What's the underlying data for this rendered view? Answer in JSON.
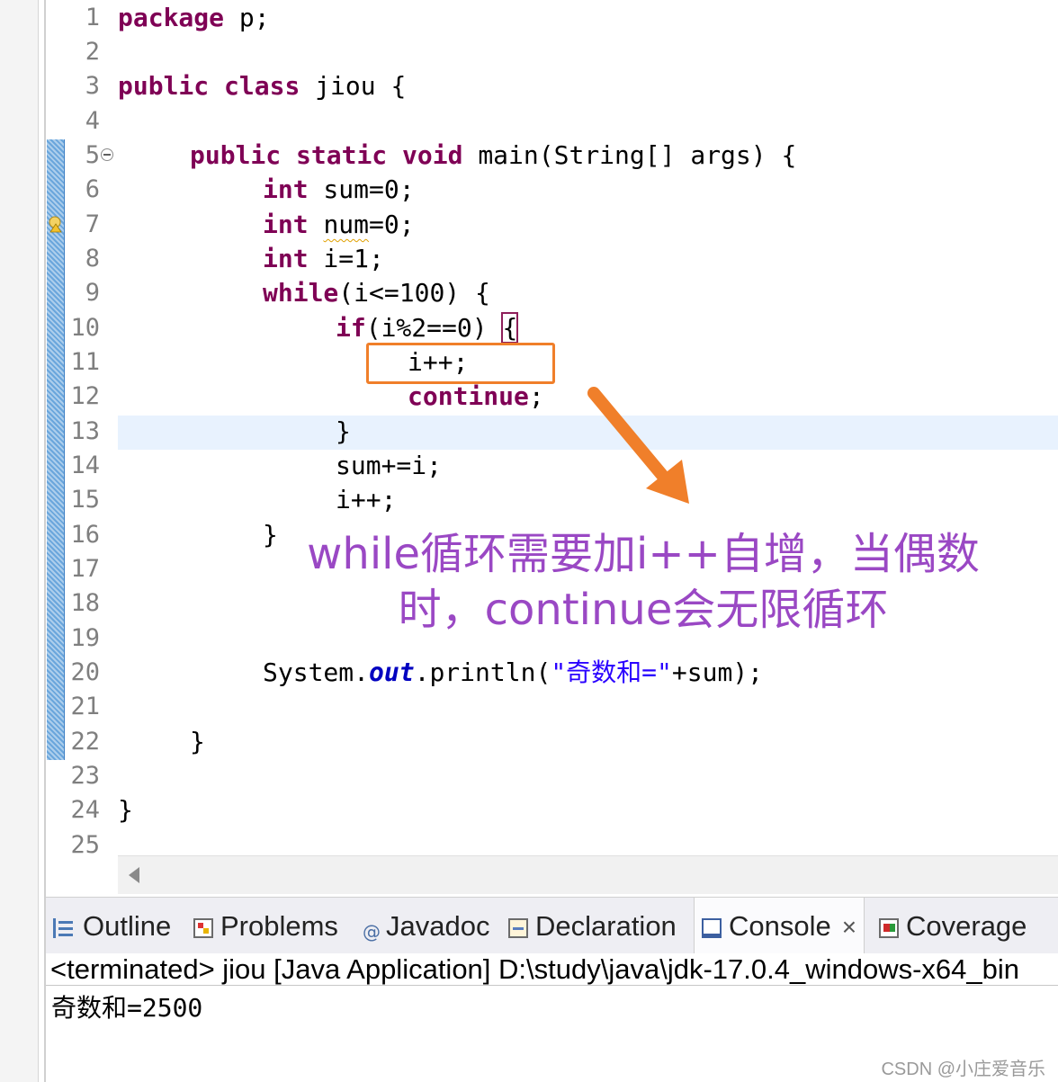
{
  "editor": {
    "line_numbers": [
      "1",
      "2",
      "3",
      "4",
      "5",
      "6",
      "7",
      "8",
      "9",
      "10",
      "11",
      "12",
      "13",
      "14",
      "15",
      "16",
      "17",
      "18",
      "19",
      "20",
      "21",
      "22",
      "23",
      "24",
      "25"
    ],
    "code": {
      "l1": {
        "kw": "package",
        "rest": " p;"
      },
      "l3": {
        "kw1": "public",
        "kw2": "class",
        "rest": " jiou {"
      },
      "l5": {
        "kw1": "public",
        "kw2": "static",
        "kw3": "void",
        "rest": " main(String[] args) {"
      },
      "l6": {
        "kw": "int",
        "rest": " sum=0;"
      },
      "l7": {
        "kw": "int",
        "var": "num",
        "rest": "=0;"
      },
      "l8": {
        "kw": "int",
        "rest": " i=1;"
      },
      "l9": {
        "kw": "while",
        "rest": "(i<=100) {"
      },
      "l10": {
        "kw": "if",
        "rest": "(i%2==0) ",
        "brace": "{"
      },
      "l11": {
        "text": "i++;"
      },
      "l12": {
        "kw": "continue",
        "rest": ";"
      },
      "l13": {
        "text": "}"
      },
      "l14": {
        "text": "sum+=i;"
      },
      "l15": {
        "text": "i++;"
      },
      "l16": {
        "text": "}"
      },
      "l20": {
        "pre": "System.",
        "field": "out",
        "mid": ".println(",
        "str": "\"奇数和=\"",
        "post": "+sum);"
      },
      "l22": {
        "text": "}"
      },
      "l24": {
        "text": "}"
      }
    }
  },
  "annotation": {
    "line1": "while循环需要加i++自增，当偶数",
    "line2": "时，continue会无限循环"
  },
  "tabs": [
    {
      "label": "Outline",
      "icon": "outline-icon"
    },
    {
      "label": "Problems",
      "icon": "problems-icon"
    },
    {
      "label": "Javadoc",
      "icon": "javadoc-icon"
    },
    {
      "label": "Declaration",
      "icon": "declaration-icon"
    },
    {
      "label": "Console",
      "icon": "console-icon",
      "active": true
    },
    {
      "label": "Coverage",
      "icon": "coverage-icon"
    }
  ],
  "console": {
    "header": "<terminated> jiou [Java Application] D:\\study\\java\\jdk-17.0.4_windows-x64_bin",
    "output": "奇数和=2500"
  },
  "watermark": "CSDN @小庄爱音乐",
  "colors": {
    "keyword": "#7f0055",
    "string": "#2a00ff",
    "field": "#0000c0",
    "annotation": "#9a48c4",
    "highlight_box": "#f07f2a",
    "current_line": "#e8f2fe"
  }
}
